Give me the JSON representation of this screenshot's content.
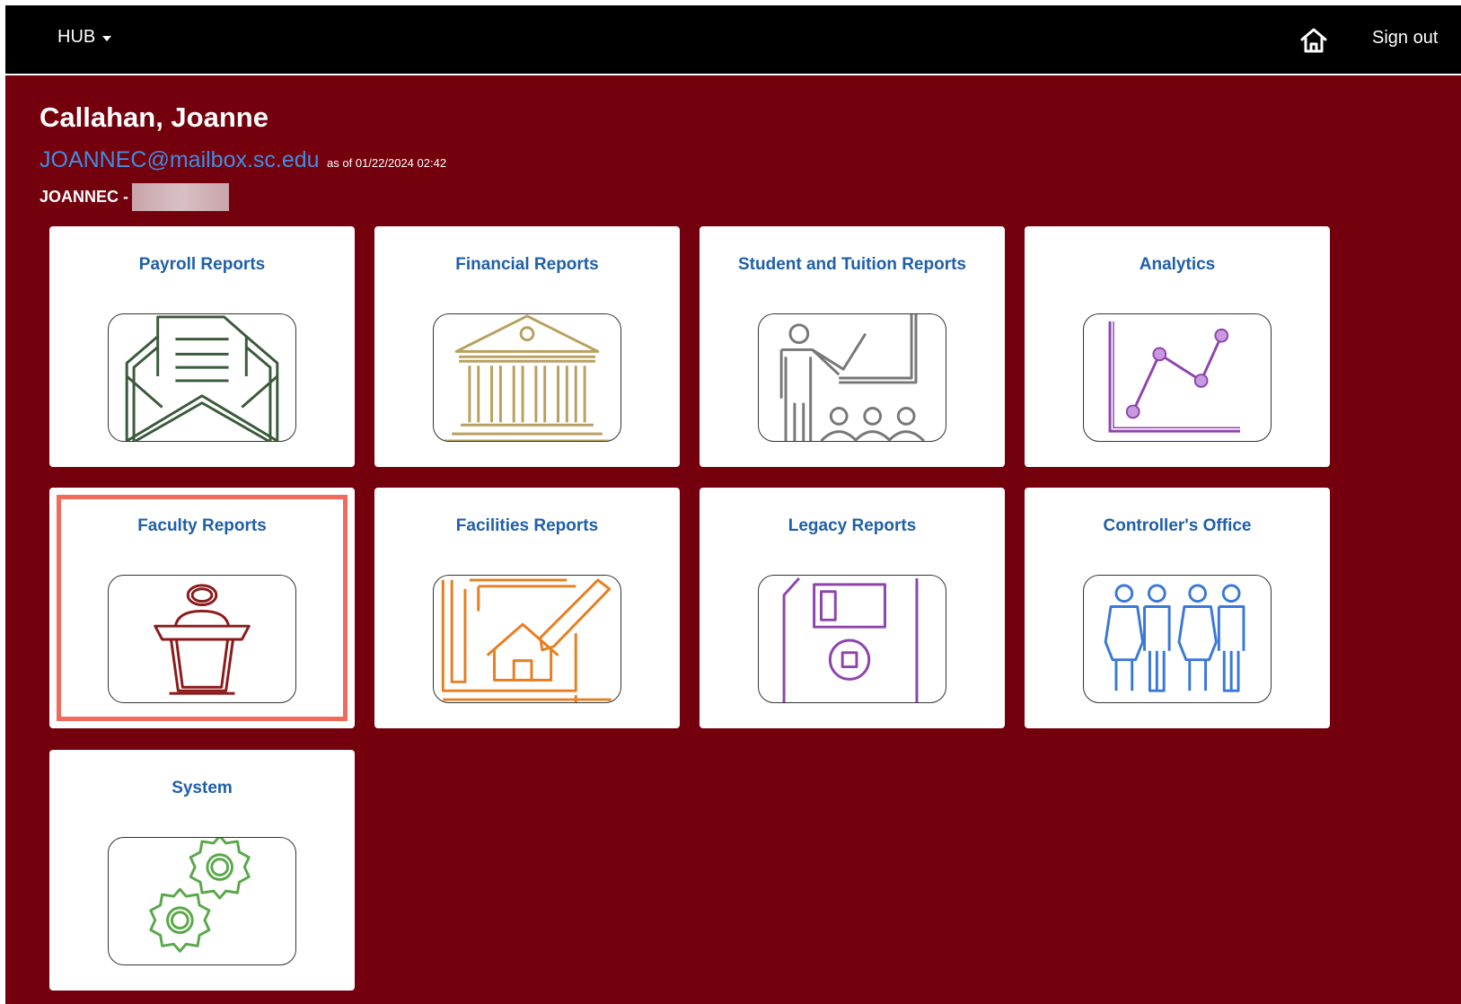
{
  "topbar": {
    "menu_label": "HUB",
    "signout_label": "Sign out",
    "icons": [
      "chevron-down-icon",
      "home-icon"
    ]
  },
  "user": {
    "name": "Callahan, Joanne",
    "email": "JOANNEC@mailbox.sc.edu",
    "as_of": "as of 01/22/2024 02:42",
    "id_label": "JOANNEC -"
  },
  "tiles": [
    {
      "title": "Payroll Reports",
      "icon": "envelope-letter-icon",
      "color": "#3a5a3a"
    },
    {
      "title": "Financial Reports",
      "icon": "bank-building-icon",
      "color": "#b8a060"
    },
    {
      "title": "Student and Tuition Reports",
      "icon": "classroom-teacher-icon",
      "color": "#777777"
    },
    {
      "title": "Analytics",
      "icon": "line-chart-icon",
      "color": "#8e44ad"
    },
    {
      "title": "Faculty Reports",
      "icon": "podium-speaker-icon",
      "color": "#8b1a1a",
      "selected": true
    },
    {
      "title": "Facilities Reports",
      "icon": "blueprint-house-icon",
      "color": "#e67e22"
    },
    {
      "title": "Legacy Reports",
      "icon": "floppy-disk-icon",
      "color": "#8e44ad"
    },
    {
      "title": "Controller's Office",
      "icon": "people-group-icon",
      "color": "#3a78d8"
    },
    {
      "title": "System",
      "icon": "gears-icon",
      "color": "#5aa84a"
    }
  ],
  "colors": {
    "background": "#75000d",
    "topbar": "#000000",
    "tile_title": "#1f5fa8",
    "email_link": "#3f8ee0",
    "selection_outline": "#f26a5b"
  }
}
